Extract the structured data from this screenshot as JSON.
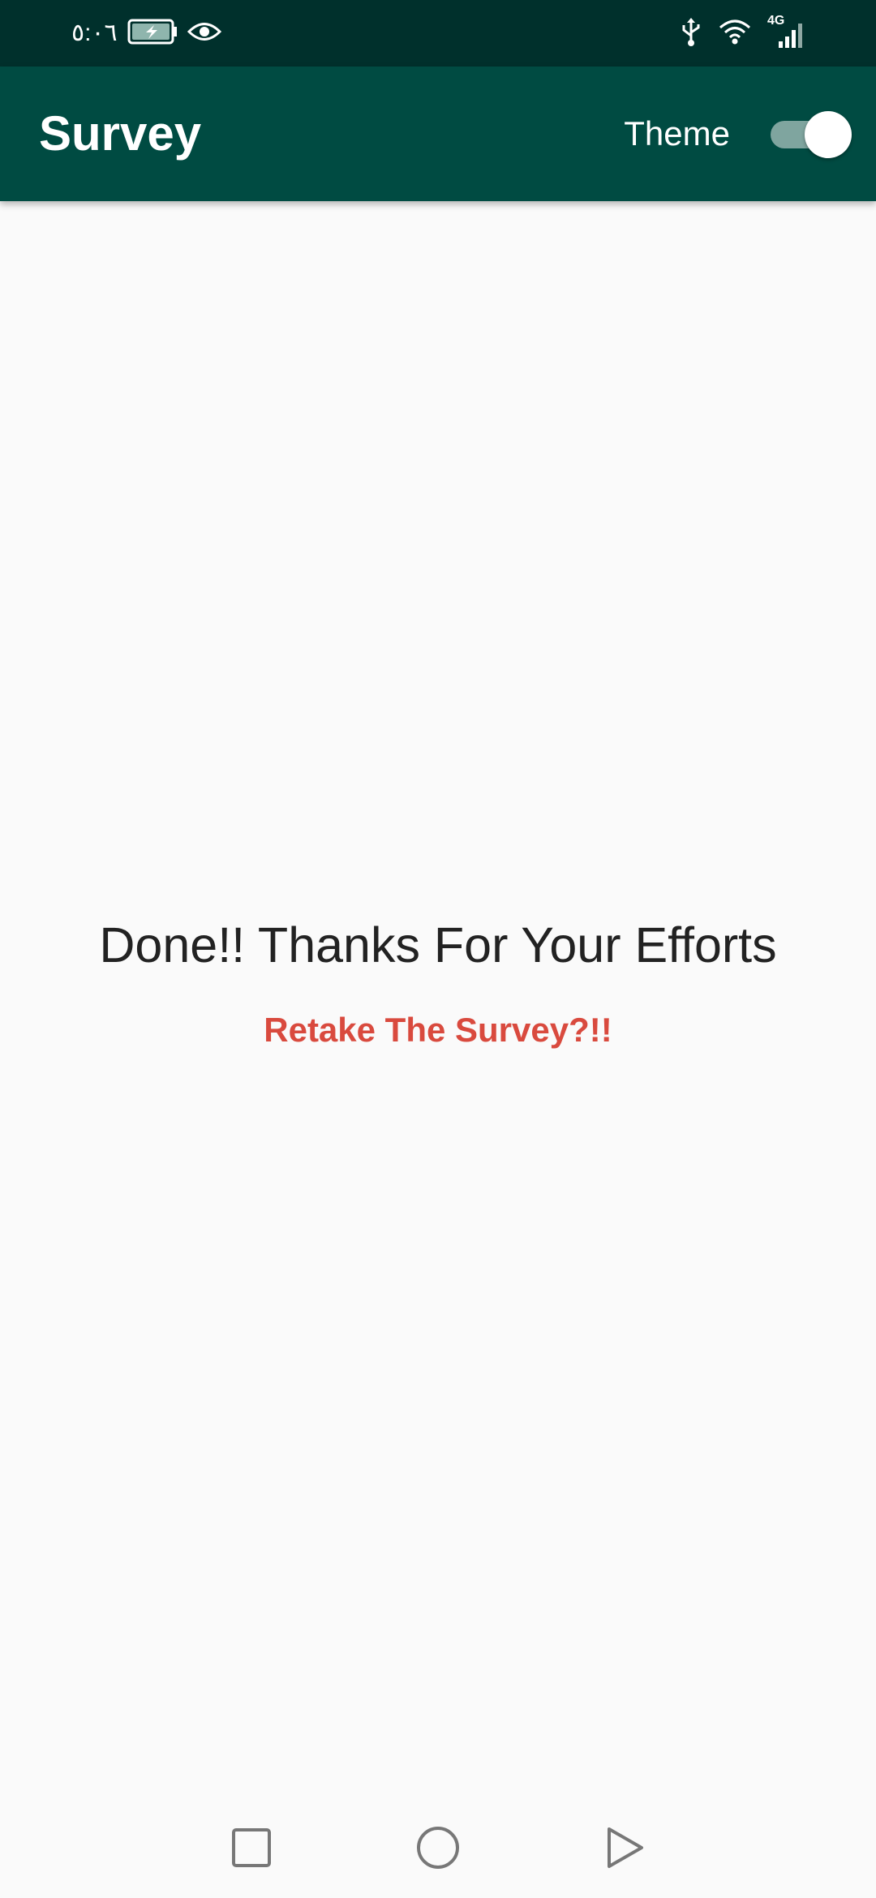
{
  "status_bar": {
    "time": "٥:٠٦",
    "icons": [
      "battery-charging-icon",
      "eye-icon",
      "usb-icon",
      "wifi-icon",
      "signal-4g-icon"
    ],
    "network_label": "4G"
  },
  "app_bar": {
    "title": "Survey",
    "theme_label": "Theme",
    "theme_switch_on": true,
    "background_color": "#004b42"
  },
  "main": {
    "message": "Done!! Thanks For Your Efforts",
    "retake_link": "Retake The Survey?!!",
    "link_color": "#d94a3e"
  },
  "nav_bar": {
    "buttons": [
      "recents-square-icon",
      "home-circle-icon",
      "back-triangle-icon"
    ]
  }
}
